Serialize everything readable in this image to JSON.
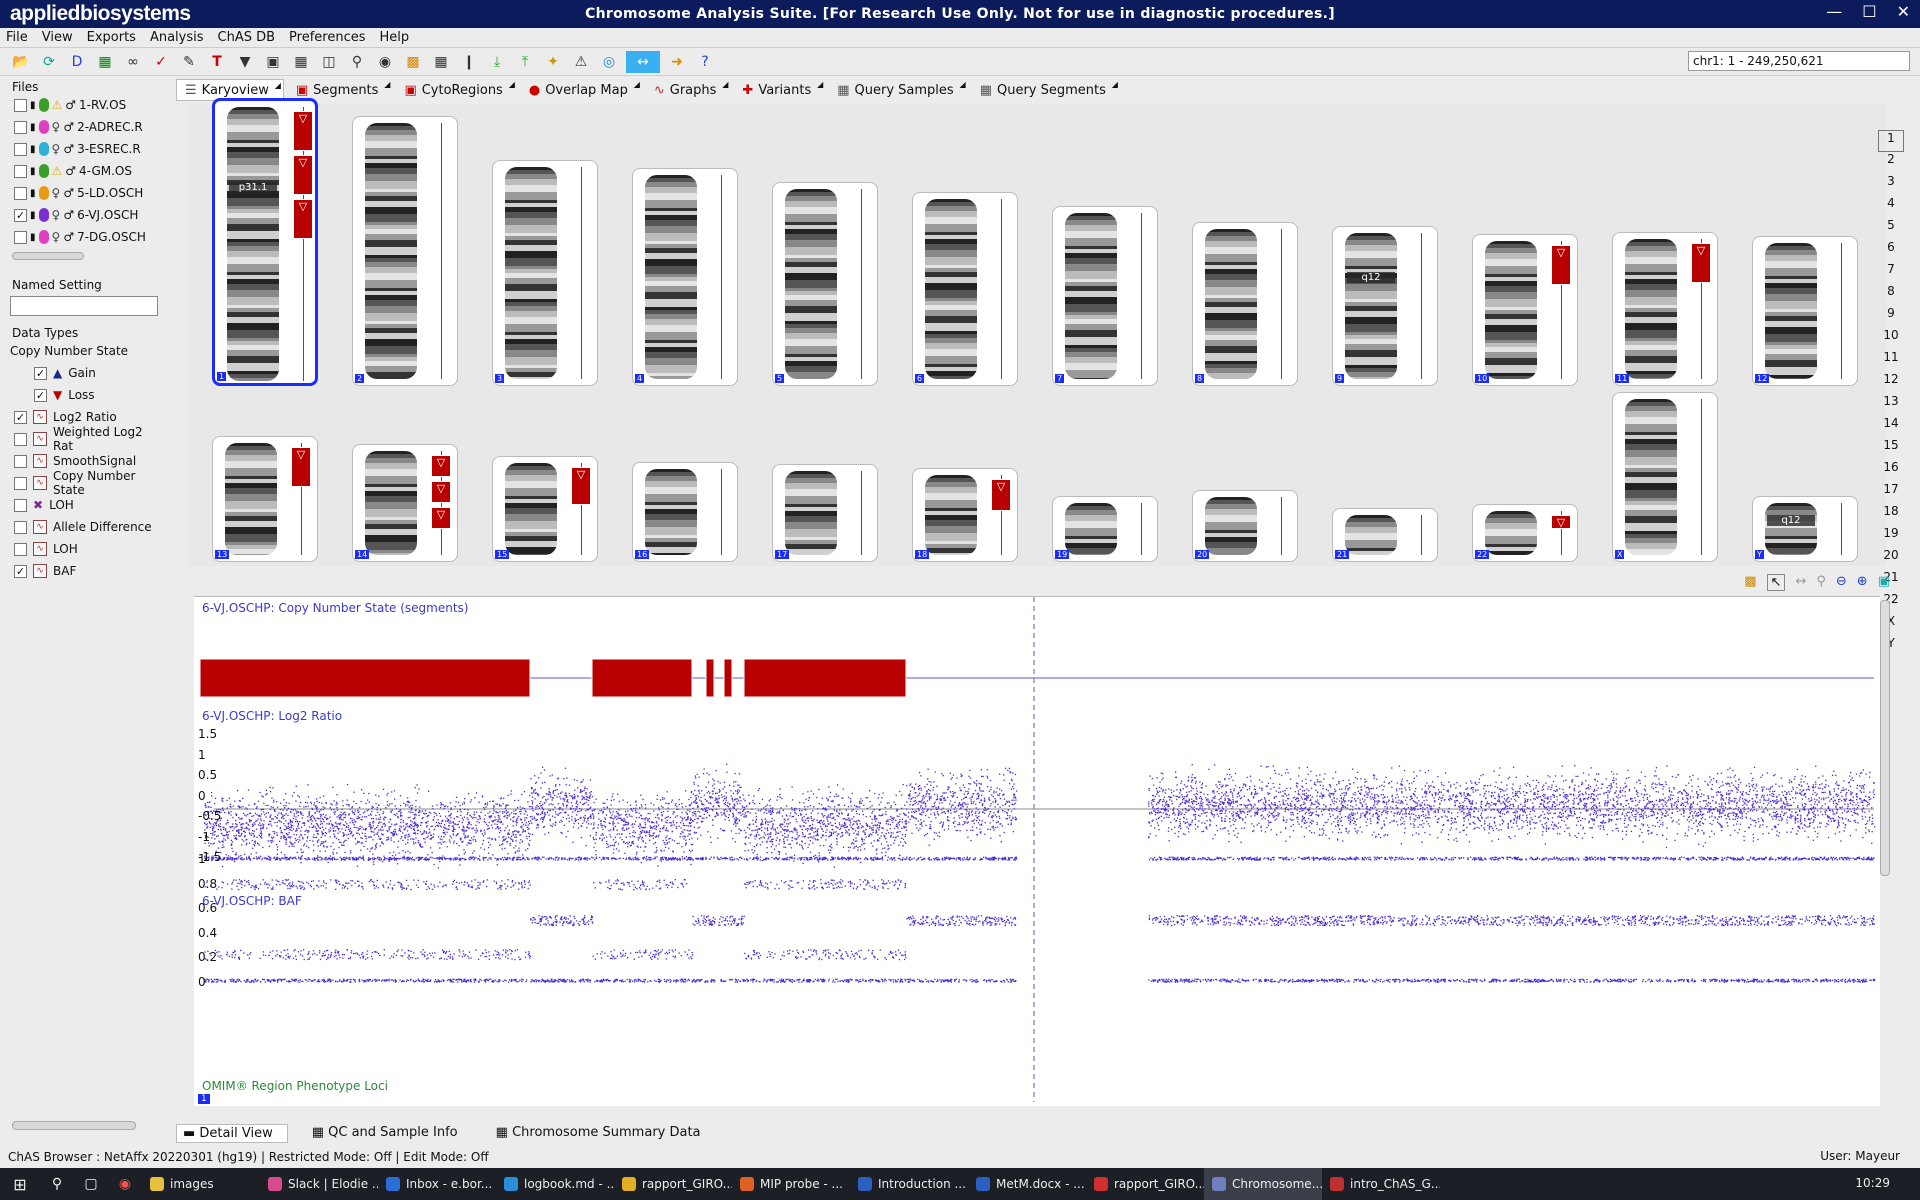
{
  "app": {
    "brand": "appliedbiosystems",
    "title": "Chromosome Analysis Suite. [For Research Use Only. Not for use in diagnostic procedures.]"
  },
  "menu": [
    "File",
    "View",
    "Exports",
    "Analysis",
    "ChAS DB",
    "Preferences",
    "Help"
  ],
  "locus": "chr1: 1 - 249,250,621",
  "files_label": "Files",
  "files": [
    {
      "name": "1-RV.OS",
      "checked": false,
      "color": "#3a9e2a",
      "warn": true
    },
    {
      "name": "2-ADREC.R",
      "checked": false,
      "color": "#e040c0",
      "warn": false
    },
    {
      "name": "3-ESREC.R",
      "checked": false,
      "color": "#2fb0d8",
      "warn": false
    },
    {
      "name": "4-GM.OS",
      "checked": false,
      "color": "#3a9e2a",
      "warn": true
    },
    {
      "name": "5-LD.OSCH",
      "checked": false,
      "color": "#e89a10",
      "warn": false
    },
    {
      "name": "6-VJ.OSCH",
      "checked": true,
      "color": "#7a30d0",
      "warn": false
    },
    {
      "name": "7-DG.OSCH",
      "checked": false,
      "color": "#e040c0",
      "warn": false
    }
  ],
  "named_setting_label": "Named Setting",
  "data_types_label": "Data Types",
  "copy_number_state_label": "Copy Number State",
  "data_types": [
    {
      "label": "Gain",
      "checked": true,
      "sub": true,
      "icon": "gain-icon"
    },
    {
      "label": "Loss",
      "checked": true,
      "sub": true,
      "icon": "loss-icon"
    },
    {
      "label": "Log2 Ratio",
      "checked": true,
      "sub": false,
      "icon": "graph-icon"
    },
    {
      "label": "Weighted Log2 Rat",
      "checked": false,
      "sub": false,
      "icon": "graph-icon"
    },
    {
      "label": "SmoothSignal",
      "checked": false,
      "sub": false,
      "icon": "graph-icon"
    },
    {
      "label": "Copy Number State",
      "checked": false,
      "sub": false,
      "icon": "graph-icon"
    },
    {
      "label": "LOH",
      "checked": false,
      "sub": false,
      "icon": "loh-icon"
    },
    {
      "label": "Allele Difference",
      "checked": false,
      "sub": false,
      "icon": "graph-icon"
    },
    {
      "label": "LOH",
      "checked": false,
      "sub": false,
      "icon": "graph-icon"
    },
    {
      "label": "BAF",
      "checked": true,
      "sub": false,
      "icon": "graph-icon"
    }
  ],
  "view_tabs": [
    "Karyoview",
    "Segments",
    "CytoRegions",
    "Overlap Map",
    "Graphs",
    "Variants",
    "Query Samples",
    "Query Segments"
  ],
  "chromosome_numbers": [
    "1",
    "2",
    "3",
    "4",
    "5",
    "6",
    "7",
    "8",
    "9",
    "10",
    "11",
    "12",
    "13",
    "14",
    "15",
    "16",
    "17",
    "18",
    "19",
    "20",
    "21",
    "22",
    "X",
    "Y"
  ],
  "band_labels": {
    "chr1": "p31.1",
    "chr9": "q12",
    "chrY": "q12"
  },
  "chromosome_copy_number_losses": {
    "1": 3,
    "10": 1,
    "11": 1,
    "14": 3,
    "15": 1,
    "18": 1,
    "22": 1,
    "13": 1
  },
  "detail": {
    "chrom_label": "1",
    "segments_track": "6-VJ.OSCHP: Copy Number State (segments)",
    "log2_track": "6-VJ.OSCHP: Log2 Ratio",
    "baf_track": "6-VJ.OSCHP: BAF",
    "omim_track": "OMIM® Region Phenotype Loci",
    "log2_ticks": [
      "1.5",
      "1",
      "0.5",
      "0",
      "-0.5",
      "-1",
      "-1.5"
    ],
    "baf_ticks": [
      "1",
      "0.8",
      "0.6",
      "0.4",
      "0.2",
      "0"
    ]
  },
  "bottom_tabs": [
    "Detail View",
    "QC and Sample Info",
    "Chromosome Summary Data"
  ],
  "status": "ChAS Browser : NetAffx 20220301 (hg19)  |  Restricted Mode: Off  |  Edit Mode: Off",
  "user": "User: Mayeur",
  "taskbar": [
    {
      "label": "images",
      "color": "#e8c040"
    },
    {
      "label": "Slack | Elodie ...",
      "color": "#d94a8c"
    },
    {
      "label": "Inbox - e.bor...",
      "color": "#2a6fd8"
    },
    {
      "label": "logbook.md - ...",
      "color": "#2a8fd8"
    },
    {
      "label": "rapport_GIRO...",
      "color": "#e0b020"
    },
    {
      "label": "MIP probe - ...",
      "color": "#e06020"
    },
    {
      "label": "Introduction ...",
      "color": "#2a5fc0"
    },
    {
      "label": "MetM.docx - ...",
      "color": "#2a5fc0"
    },
    {
      "label": "rapport_GIRO...",
      "color": "#d03030"
    },
    {
      "label": "Chromosome...",
      "color": "#7080c0"
    },
    {
      "label": "intro_ChAS_G...",
      "color": "#c03030"
    }
  ],
  "clock": "10:29"
}
